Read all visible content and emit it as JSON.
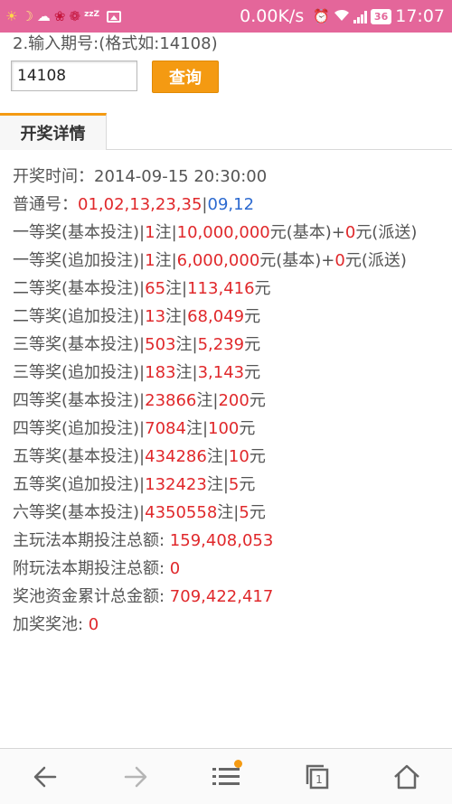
{
  "status_bar": {
    "speed": "0.00K/s",
    "battery": "36",
    "time": "17:07",
    "icons": [
      "sun-icon",
      "moon-icon",
      "cloud-icon",
      "flower-icon",
      "flower-icon",
      "sleep-icon",
      "image-icon",
      "alarm-icon",
      "wifi-icon",
      "signal-icon",
      "battery-icon"
    ]
  },
  "query": {
    "label": "2.输入期号:(格式如:14108)",
    "input_value": "14108",
    "button_label": "查询"
  },
  "tab": {
    "label": "开奖详情"
  },
  "details": {
    "draw_time_label": "开奖时间：",
    "draw_time": "2014-09-15 20:30:00",
    "numbers_label": "普通号：",
    "front_numbers": "01,02,13,23,35",
    "sep": "|",
    "back_numbers": "09,12",
    "prizes": [
      {
        "name": "一等奖(基本投注)",
        "count": "1",
        "unit": "注",
        "amount": "10,000,000",
        "suffix": "元(基本)+",
        "extra": "0",
        "extra_suffix": "元(派送)"
      },
      {
        "name": "一等奖(追加投注)",
        "count": "1",
        "unit": "注",
        "amount": "6,000,000",
        "suffix": "元(基本)+",
        "extra": "0",
        "extra_suffix": "元(派送)"
      },
      {
        "name": "二等奖(基本投注)",
        "count": "65",
        "unit": "注",
        "amount": "113,416",
        "suffix": "元"
      },
      {
        "name": "二等奖(追加投注)",
        "count": "13",
        "unit": "注",
        "amount": "68,049",
        "suffix": "元"
      },
      {
        "name": "三等奖(基本投注)",
        "count": "503",
        "unit": "注",
        "amount": "5,239",
        "suffix": "元"
      },
      {
        "name": "三等奖(追加投注)",
        "count": "183",
        "unit": "注",
        "amount": "3,143",
        "suffix": "元"
      },
      {
        "name": "四等奖(基本投注)",
        "count": "23866",
        "unit": "注",
        "amount": "200",
        "suffix": "元"
      },
      {
        "name": "四等奖(追加投注)",
        "count": "7084",
        "unit": "注",
        "amount": "100",
        "suffix": "元"
      },
      {
        "name": "五等奖(基本投注)",
        "count": "434286",
        "unit": "注",
        "amount": "10",
        "suffix": "元"
      },
      {
        "name": "五等奖(追加投注)",
        "count": "132423",
        "unit": "注",
        "amount": "5",
        "suffix": "元"
      },
      {
        "name": "六等奖(基本投注)",
        "count": "4350558",
        "unit": "注",
        "amount": "5",
        "suffix": "元"
      }
    ],
    "totals": [
      {
        "label": "主玩法本期投注总额: ",
        "value": "159,408,053"
      },
      {
        "label": "附玩法本期投注总额: ",
        "value": "0"
      },
      {
        "label": "奖池资金累计总金额: ",
        "value": "709,422,417"
      },
      {
        "label": "加奖奖池: ",
        "value": "0"
      }
    ]
  },
  "bottom_nav": {
    "tabs_count": "1",
    "items": [
      "back-icon",
      "forward-icon",
      "menu-icon",
      "tabs-icon",
      "home-icon"
    ]
  },
  "colors": {
    "status_bar": "#e4669a",
    "accent": "#f49a12",
    "value_red": "#e0282b",
    "value_blue": "#2c6ad0"
  }
}
